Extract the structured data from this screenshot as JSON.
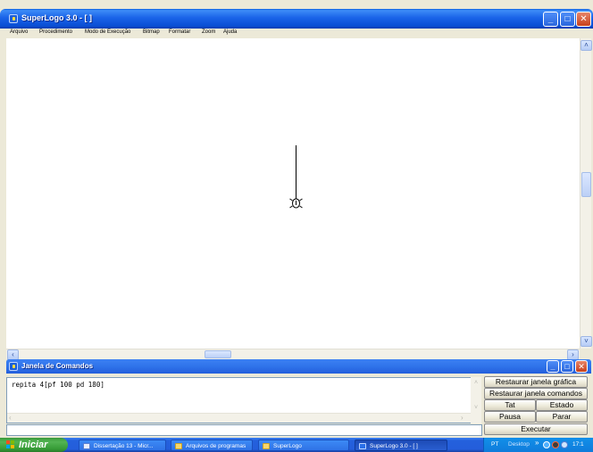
{
  "window": {
    "title": "SuperLogo 3.0 - [ ]",
    "menu": [
      "Arquivo",
      "Procedimento",
      "Modo de Execução",
      "Bitmap",
      "Formatar",
      "Zoom",
      "Ajuda"
    ]
  },
  "command_window": {
    "title": "Janela de Comandos",
    "history_text": "repita 4[pf 100 pd 180]",
    "input_value": "",
    "buttons": {
      "restore_graphic": "Restaurar janela gráfica",
      "restore_commands": "Restaurar janela comandos",
      "tat": "Tat",
      "estado": "Estado",
      "pausa": "Pausa",
      "parar": "Parar",
      "executar": "Executar"
    }
  },
  "taskbar": {
    "start_label": "Iniciar",
    "tasks": [
      "Dissertação 13 - Micr...",
      "Arquivos de programas",
      "SuperLogo",
      "SuperLogo 3.0 - [ ]"
    ],
    "tray": {
      "language": "PT",
      "desktop": "Desktop",
      "chevron": "»",
      "time": "17:1"
    }
  },
  "colors": {
    "titlebar_blue": "#245EDB",
    "close_red": "#C7401B",
    "start_green": "#359A35",
    "window_face": "#ECE9D8"
  }
}
